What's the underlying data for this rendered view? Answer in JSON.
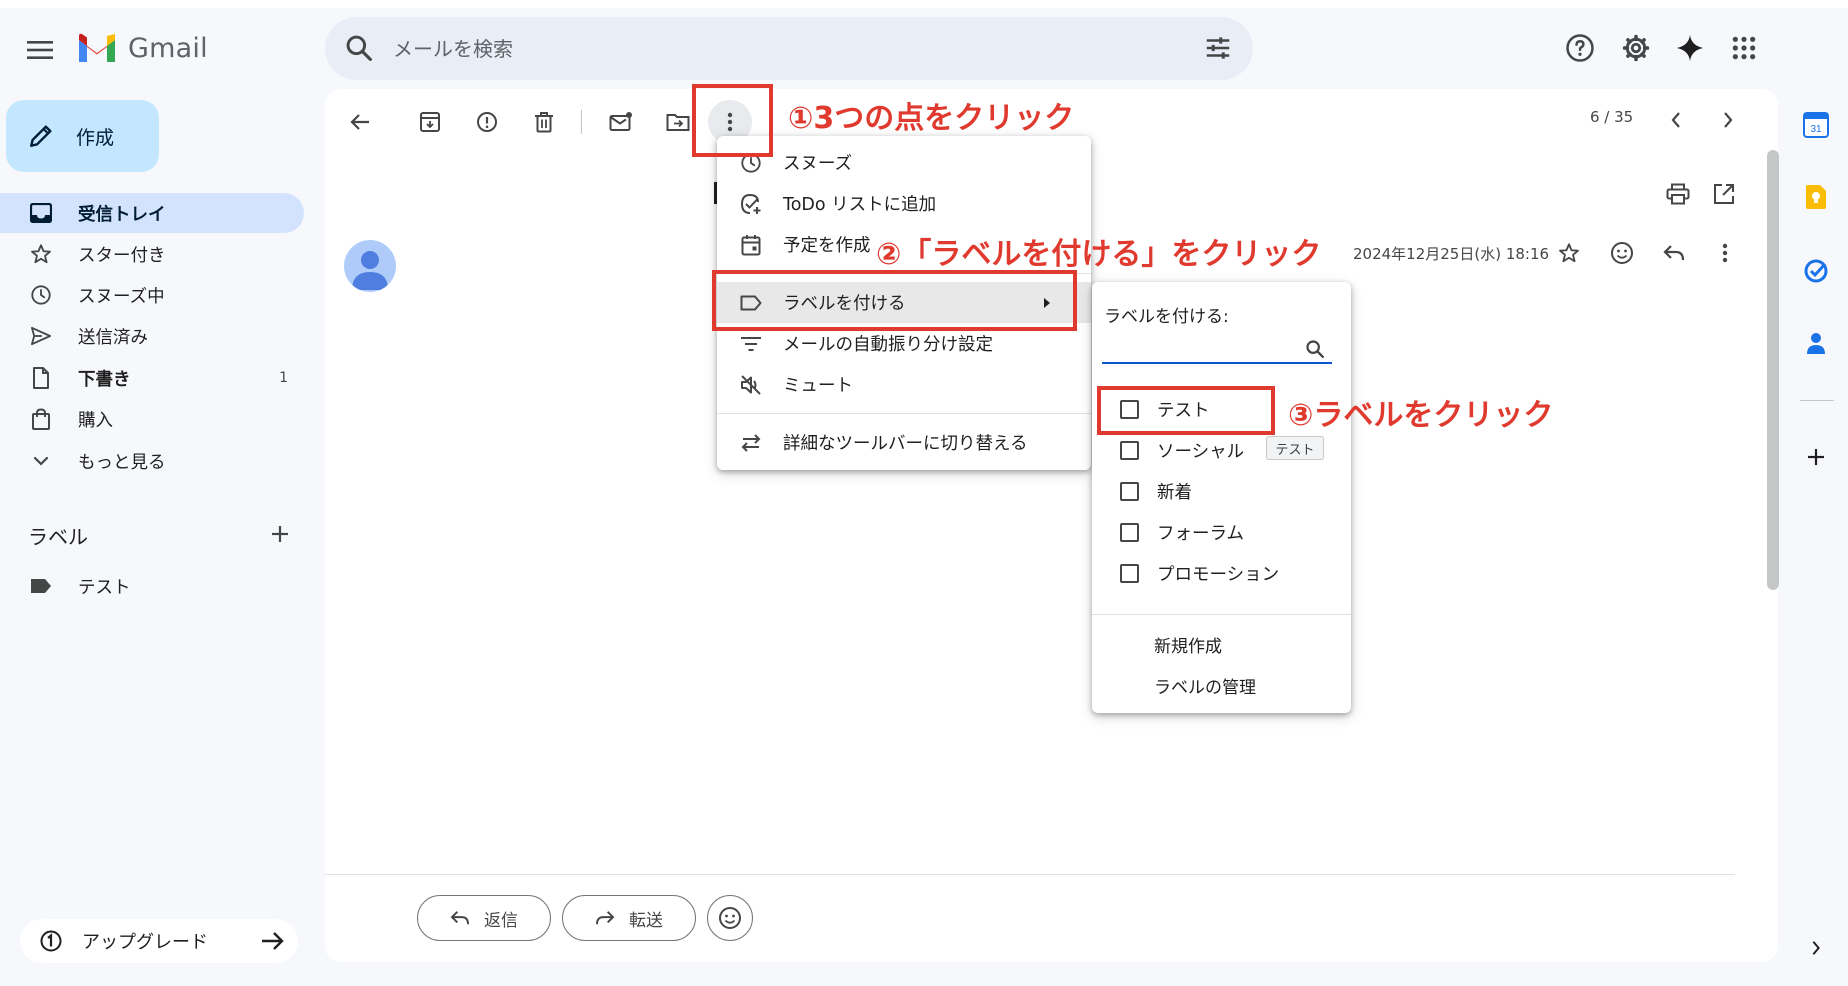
{
  "app": {
    "name": "Gmail"
  },
  "search": {
    "placeholder": "メールを検索"
  },
  "compose": {
    "label": "作成"
  },
  "sidebar": {
    "items": [
      {
        "label": "受信トレイ",
        "icon": "inbox-icon"
      },
      {
        "label": "スター付き",
        "icon": "star-icon"
      },
      {
        "label": "スヌーズ中",
        "icon": "clock-icon"
      },
      {
        "label": "送信済み",
        "icon": "send-icon"
      },
      {
        "label": "下書き",
        "icon": "draft-icon",
        "count": "1"
      },
      {
        "label": "購入",
        "icon": "shopping-bag-icon"
      },
      {
        "label": "もっと見る",
        "icon": "chevron-down-icon"
      }
    ],
    "labels_header": "ラベル",
    "user_labels": [
      {
        "label": "テスト",
        "icon": "label-tag-icon"
      }
    ],
    "upgrade_label": "アップグレード"
  },
  "toolbar": {
    "pager": "6 / 35"
  },
  "message": {
    "date": "2024年12月25日(水) 18:16"
  },
  "actions": {
    "reply": "返信",
    "forward": "転送"
  },
  "more_menu": {
    "items": [
      {
        "label": "スヌーズ",
        "icon": "clock-icon"
      },
      {
        "label": "ToDo リストに追加",
        "icon": "add-task-icon"
      },
      {
        "label": "予定を作成",
        "icon": "calendar-icon"
      },
      {
        "label": "ラベルを付ける",
        "icon": "label-icon"
      },
      {
        "label": "メールの自動振り分け設定",
        "icon": "filter-icon"
      },
      {
        "label": "ミュート",
        "icon": "mute-icon"
      },
      {
        "label": "詳細なツールバーに切り替える",
        "icon": "swap-icon"
      }
    ]
  },
  "label_submenu": {
    "title": "ラベルを付ける:",
    "options": [
      "テスト",
      "ソーシャル",
      "新着",
      "フォーラム",
      "プロモーション"
    ],
    "create_new": "新規作成",
    "manage": "ラベルの管理",
    "tooltip": "テスト"
  },
  "annotations": {
    "step1": "①3つの点をクリック",
    "step2": "②「ラベルを付ける」をクリック",
    "step3": "③ラベルをクリック",
    "color": "#e03a2f"
  },
  "colors": {
    "accent": "#0b57d0",
    "compose_bg": "#c2e7ff",
    "active_nav_bg": "#d3e3fd",
    "page_bg": "#f6f8fc"
  }
}
